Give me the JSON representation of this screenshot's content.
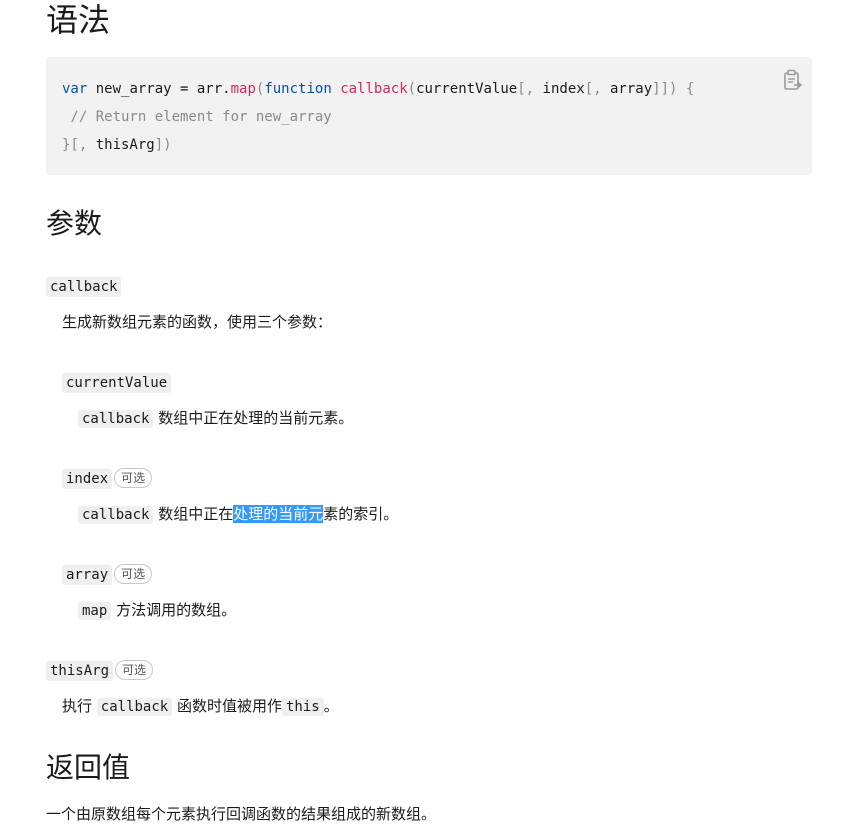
{
  "headings": {
    "syntax": "语法",
    "parameters": "参数",
    "return_value": "返回值"
  },
  "code": {
    "line1": {
      "var": "var",
      "t1": " new_array = arr.",
      "map": "map",
      "p1": "(",
      "function": "function",
      "sp": " ",
      "callback": "callback",
      "p2": "(",
      "currentValue": "currentValue",
      "b1": "[, ",
      "index": "index",
      "b2": "[, ",
      "array": "array",
      "b3": "]]) {"
    },
    "line2": " // Return element for new_array",
    "line3": {
      "b1": "}[, ",
      "thisArg": "thisArg",
      "b2": "])"
    },
    "copy_icon": "clipboard-copy-icon"
  },
  "params": {
    "callback": {
      "name": "callback",
      "desc": "生成新数组元素的函数，使用三个参数："
    },
    "currentValue": {
      "name": "currentValue",
      "code": "callback",
      "desc": " 数组中正在处理的当前元素。"
    },
    "index": {
      "name": "index",
      "badge": "可选",
      "code": "callback",
      "desc_pre": " 数组中正在",
      "desc_hl": "处理的当前元",
      "desc_post": "素的索引。"
    },
    "array": {
      "name": "array",
      "badge": "可选",
      "code": "map",
      "desc": " 方法调用的数组。"
    },
    "thisArg": {
      "name": "thisArg",
      "badge": "可选",
      "pre": "执行 ",
      "code1": "callback",
      "mid": " 函数时值被用作",
      "code2": "this",
      "post": "。"
    }
  },
  "return_desc": "一个由原数组每个元素执行回调函数的结果组成的新数组。"
}
